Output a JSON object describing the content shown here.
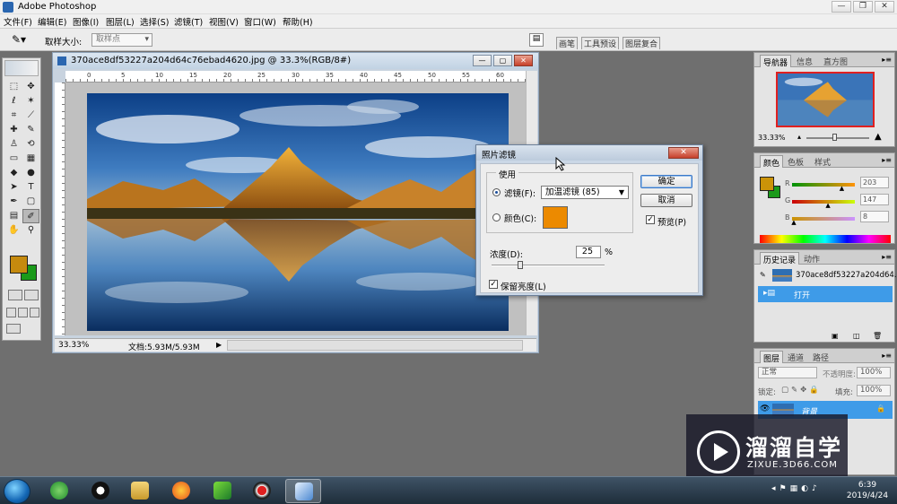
{
  "app": {
    "title": "Adobe Photoshop"
  },
  "menu": [
    "文件(F)",
    "编辑(E)",
    "图像(I)",
    "图层(L)",
    "选择(S)",
    "滤镜(T)",
    "视图(V)",
    "窗口(W)",
    "帮助(H)"
  ],
  "options_bar": {
    "sample_size_label": "取样大小:",
    "sample_size_value": "取样点",
    "well_tabs": [
      "画笔",
      "工具预设",
      "图层复合"
    ]
  },
  "toolbox": {
    "foreground_color": "#c58a0e",
    "background_color": "#1a9a1a"
  },
  "document": {
    "title": "370ace8df53227a204d64c76ebad4620.jpg @ 33.3%(RGB/8#)",
    "ruler_marks": [
      "0",
      "5",
      "10",
      "15",
      "20",
      "25",
      "30",
      "35",
      "40",
      "45",
      "50",
      "55",
      "60"
    ],
    "zoom": "33.33%",
    "doc_info": "文档:5.93M/5.93M"
  },
  "dialog": {
    "title": "照片滤镜",
    "use_group": "使用",
    "filter_label": "滤镜(F):",
    "filter_value": "加温滤镜 (85)",
    "color_label": "颜色(C):",
    "color_swatch": "#ec8a00",
    "density_label": "浓度(D):",
    "density_value": "25",
    "percent": "%",
    "density": 25,
    "preserve_label": "保留亮度(L)",
    "preserve_checked": true,
    "ok_label": "确定",
    "cancel_label": "取消",
    "preview_label": "预览(P)",
    "preview_checked": true
  },
  "navigator": {
    "tabs": [
      "导航器",
      "信息",
      "直方图"
    ],
    "zoom": "33.33%"
  },
  "color_panel": {
    "tabs": [
      "颜色",
      "色板",
      "样式"
    ],
    "r_label": "R",
    "g_label": "G",
    "b_label": "B",
    "r": "203",
    "g": "147",
    "b": "8",
    "r_value": 203,
    "g_value": 147,
    "b_value": 8,
    "foreground": "#cb9308",
    "background": "#1a9a1a"
  },
  "history_panel": {
    "tabs": [
      "历史记录",
      "动作"
    ],
    "snapshot": "370ace8df53227a204d64...",
    "items": [
      "打开"
    ]
  },
  "layers_panel": {
    "tabs": [
      "图层",
      "通道",
      "路径"
    ],
    "blend_mode": "正常",
    "opacity_label": "不透明度:",
    "opacity": "100%",
    "lock_label": "锁定:",
    "fill_label": "填充:",
    "fill": "100%",
    "layers": [
      "背景"
    ]
  },
  "watermark": {
    "name": "溜溜自学",
    "url": "ZIXUE.3D66.COM"
  },
  "taskbar": {
    "time": "6:39",
    "date": "2019/4/24"
  }
}
